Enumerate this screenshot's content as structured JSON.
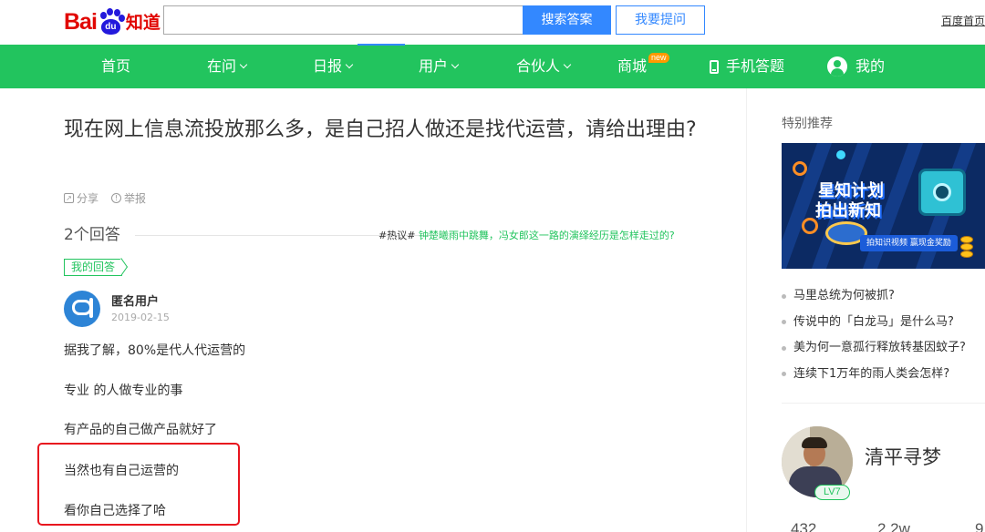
{
  "header": {
    "logo": {
      "part1": "Bai",
      "part2": "du",
      "part3": "知道"
    },
    "search": {
      "value": "",
      "placeholder": "",
      "button_label": "搜索答案"
    },
    "ask_button_label": "我要提问",
    "home_link": "百度首页"
  },
  "nav": {
    "items": [
      {
        "label": "首页",
        "dropdown": false
      },
      {
        "label": "在问",
        "dropdown": true
      },
      {
        "label": "日报",
        "dropdown": true
      },
      {
        "label": "用户",
        "dropdown": true
      },
      {
        "label": "合伙人",
        "dropdown": true
      },
      {
        "label": "商城",
        "badge": "new"
      },
      {
        "label": "手机答题",
        "icon": "phone-icon"
      },
      {
        "label": "我的",
        "icon": "user-icon"
      }
    ]
  },
  "question": {
    "title": "现在网上信息流投放那么多，是自己招人做还是找代运营，请给出理由?",
    "actions": {
      "share": "分享",
      "report": "举报"
    },
    "answer_count": "2个回答",
    "hot_topic": {
      "prefix": "#热议#",
      "text": "钟楚曦雨中跳舞，冯女郎这一路的演绎经历是怎样走过的?"
    }
  },
  "answer": {
    "tag": "我的回答",
    "user": "匿名用户",
    "date": "2019-02-15",
    "lines": [
      "据我了解，80%是代人代运营的",
      "专业 的人做专业的事",
      "有产品的自己做产品就好了",
      "当然也有自己运营的",
      "看你自己选择了哈"
    ]
  },
  "sidebar": {
    "title": "特别推荐",
    "banner": {
      "line1": "星知计划",
      "line2": "拍出新知",
      "pill": "拍知识视频 赢现金奖励"
    },
    "recommendations": [
      "马里总统为何被抓?",
      "传说中的「白龙马」是什么马?",
      "美为何一意孤行释放转基因蚊子?",
      "连续下1万年的雨人类会怎样?"
    ],
    "profile": {
      "name": "清平寻梦",
      "level": "LV7",
      "stats": [
        "432",
        "2.2w",
        "9"
      ]
    }
  },
  "colors": {
    "nav_green": "#22c45e",
    "search_blue": "#3388ff",
    "logo_red": "#e10601",
    "logo_blue": "#2319dc",
    "highlight_red": "#e8141e"
  }
}
